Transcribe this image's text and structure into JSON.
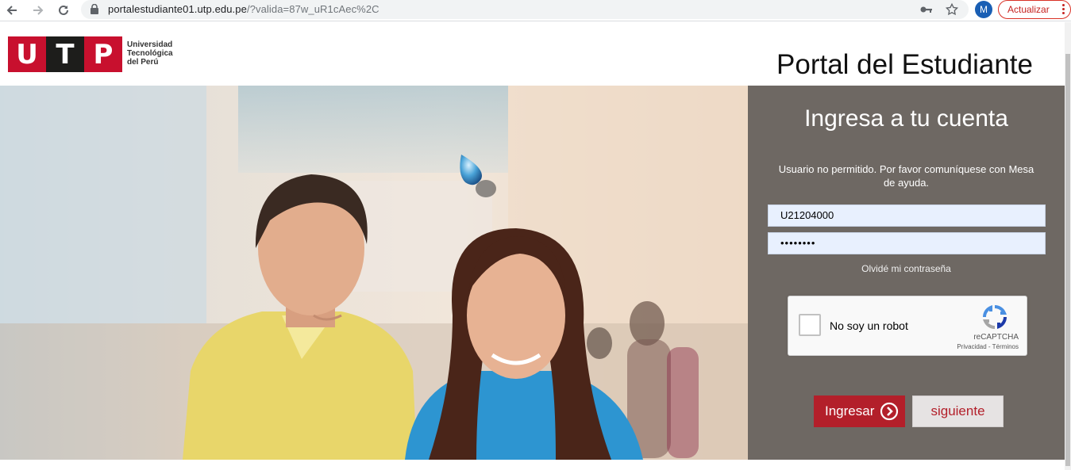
{
  "browser": {
    "url_host": "portalestudiante01.utp.edu.pe",
    "url_rest": "/?valida=87w_uR1cAec%2C",
    "avatar_letter": "M",
    "update_label": "Actualizar"
  },
  "header": {
    "logo_letters": [
      "U",
      "T",
      "P"
    ],
    "logo_text_line1": "Universidad",
    "logo_text_line2": "Tecnológica",
    "logo_text_line3": "del Perú",
    "title": "Portal del Estudiante"
  },
  "login": {
    "title": "Ingresa a tu cuenta",
    "message": "Usuario no permitido. Por favor comuníquese con Mesa de ayuda.",
    "username_value": "U21204000",
    "password_value": "••••••••",
    "forgot_label": "Olvidé mi contraseña",
    "captcha_label": "No soy un robot",
    "captcha_brand": "reCAPTCHA",
    "captcha_links": "Privacidad - Términos",
    "submit_label": "Ingresar",
    "next_label": "siguiente"
  },
  "colors": {
    "brand_red": "#c8102e",
    "panel_bg": "#6e6863",
    "button_red": "#b31f2a"
  }
}
